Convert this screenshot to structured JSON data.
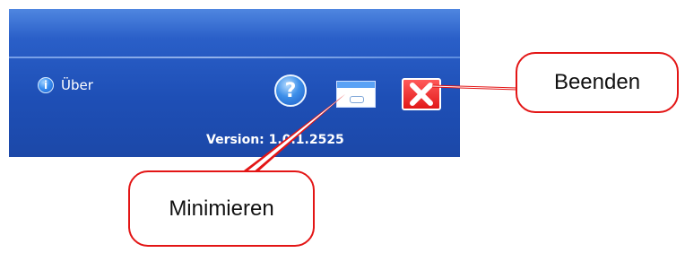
{
  "app": {
    "about_label": "Über",
    "version_text": "Version: 1.0.1.2525"
  },
  "buttons": {
    "help_icon": "question-mark",
    "minimize_icon": "minimize-window",
    "close_icon": "red-x"
  },
  "callouts": {
    "close": "Beenden",
    "minimize": "Minimieren"
  },
  "colors": {
    "panel_blue": "#1e4fb6",
    "callout_border": "#e31515",
    "close_red": "#e11818"
  }
}
